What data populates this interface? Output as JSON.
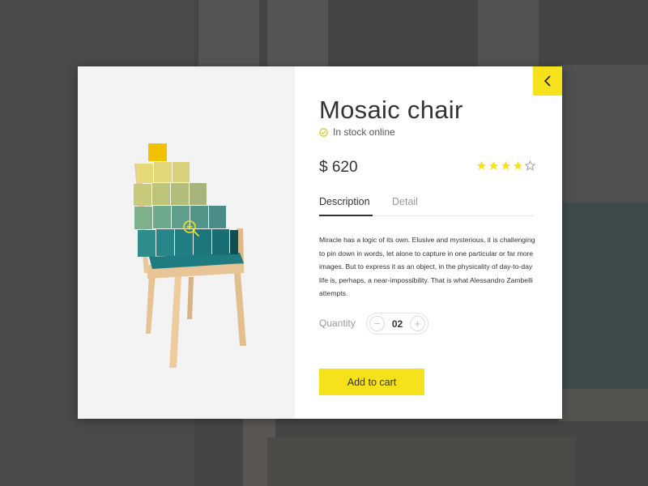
{
  "product": {
    "title": "Mosaic chair",
    "stock_status": "In stock online",
    "price": "$ 620",
    "rating": 4,
    "rating_max": 5
  },
  "tabs": [
    {
      "label": "Description",
      "active": true
    },
    {
      "label": "Detail",
      "active": false
    }
  ],
  "description": "Miracle has a logic of its own. Elusive and mysterious, it is challenging to pin down in words, let alone to capture in one particular or far more images. But to express it as an object, in the physicality of day-to-day life is, perhaps, a near-impossibility. That is what Alessandro Zambelli attempts.",
  "quantity": {
    "label": "Quantity",
    "value": "02",
    "minus": "−",
    "plus": "+"
  },
  "cart_button": "Add to cart",
  "icons": {
    "back": "chevron-left-icon",
    "zoom": "zoom-in-icon",
    "stock": "check-circle-icon",
    "star": "star-icon"
  },
  "colors": {
    "accent": "#f5e21b",
    "background": "#3d3d3d",
    "image_panel": "#f3f3f3"
  }
}
